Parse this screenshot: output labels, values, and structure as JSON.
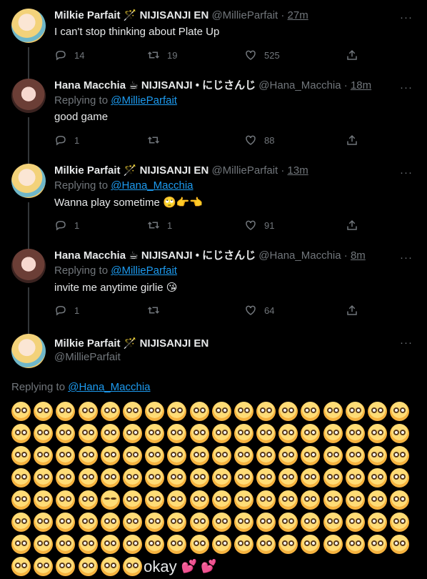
{
  "tweets": [
    {
      "name": "Milkie Parfait",
      "badge": "🪄",
      "org": "NIJISANJI EN",
      "handle": "@MillieParfait",
      "dot": "·",
      "time": "27m",
      "replying_prefix": "",
      "replying_to": "",
      "text": "I can't stop thinking about Plate Up",
      "emoji": "",
      "replies": "14",
      "retweets": "19",
      "likes": "525"
    },
    {
      "name": "Hana Macchia",
      "badge": "☕",
      "org": "NIJISANJI • にじさんじ",
      "handle": "@Hana_Macchia",
      "dot": "·",
      "time": "18m",
      "replying_prefix": "Replying to",
      "replying_to": "@MillieParfait",
      "text": "good game",
      "emoji": "",
      "replies": "1",
      "retweets": "",
      "likes": "88"
    },
    {
      "name": "Milkie Parfait",
      "badge": "🪄",
      "org": "NIJISANJI EN",
      "handle": "@MillieParfait",
      "dot": "·",
      "time": "13m",
      "replying_prefix": "Replying to",
      "replying_to": "@Hana_Macchia",
      "text": "Wanna play sometime",
      "emoji": "🙄👉👈",
      "replies": "1",
      "retweets": "1",
      "likes": "91"
    },
    {
      "name": "Hana Macchia",
      "badge": "☕",
      "org": "NIJISANJI • にじさんじ",
      "handle": "@Hana_Macchia",
      "dot": "·",
      "time": "8m",
      "replying_prefix": "Replying to",
      "replying_to": "@MillieParfait",
      "text": "invite me anytime girlie",
      "emoji": "😘",
      "replies": "1",
      "retweets": "",
      "likes": "64"
    }
  ],
  "main_tweet": {
    "name": "Milkie Parfait",
    "badge": "🪄",
    "org": "NIJISANJI EN",
    "handle": "@MillieParfait",
    "replying_prefix": "Replying to",
    "replying_to": "@Hana_Macchia",
    "emoji_rows": 8,
    "emoji_per_row": 18,
    "last_row_count": 6,
    "crying_position": [
      4,
      4
    ],
    "closing_text": "okay",
    "hearts": "💕 💕"
  },
  "icons": {
    "reply": "reply-icon",
    "retweet": "retweet-icon",
    "like": "heart-icon",
    "share": "share-icon",
    "more": "more-icon"
  },
  "colors": {
    "link": "#1d9bf0",
    "muted": "#71767b",
    "text": "#e7e9ea"
  }
}
